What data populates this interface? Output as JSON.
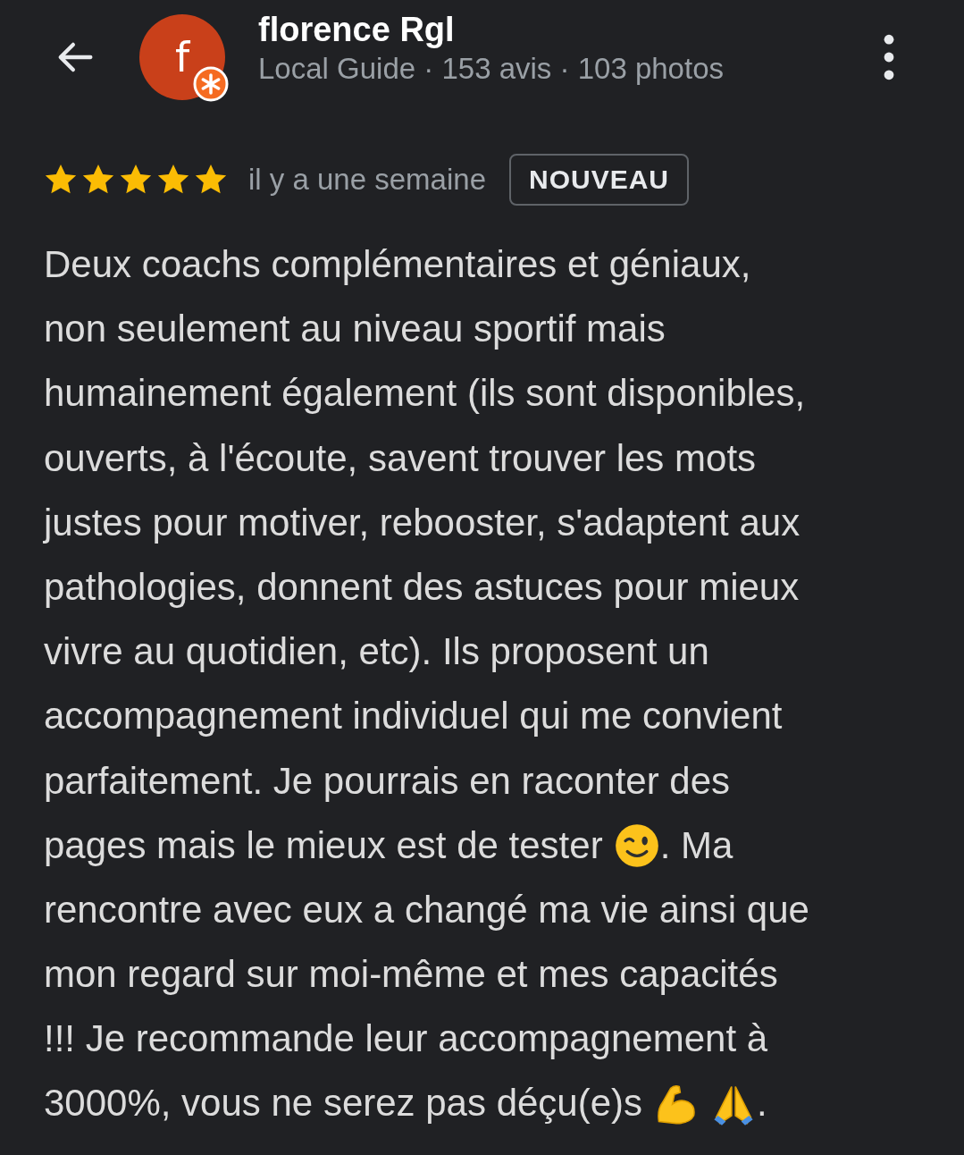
{
  "header": {
    "name": "florence Rgl",
    "avatar_letter": "f",
    "subtitle": "Local Guide · 153 avis · 103 photos"
  },
  "review": {
    "stars": 5,
    "time": "il y a une semaine",
    "badge": "NOUVEAU",
    "lines": [
      [
        {
          "kind": "text",
          "text": "Deux coachs complémentaires et géniaux,"
        }
      ],
      [
        {
          "kind": "text",
          "text": "non seulement au niveau sportif mais"
        }
      ],
      [
        {
          "kind": "text",
          "text": "humainement également (ils sont disponibles,"
        }
      ],
      [
        {
          "kind": "text",
          "text": "ouverts, à l'écoute, savent trouver les mots"
        }
      ],
      [
        {
          "kind": "text",
          "text": "justes pour motiver, rebooster, s'adaptent aux"
        }
      ],
      [
        {
          "kind": "text",
          "text": "pathologies, donnent des astuces pour mieux"
        }
      ],
      [
        {
          "kind": "text",
          "text": "vivre au quotidien, etc). Ils proposent un"
        }
      ],
      [
        {
          "kind": "text",
          "text": "accompagnement individuel qui me convient"
        }
      ],
      [
        {
          "kind": "text",
          "text": "parfaitement. Je pourrais en raconter des"
        }
      ],
      [
        {
          "kind": "text",
          "text": "pages mais le mieux est de tester"
        },
        {
          "kind": "wink"
        },
        {
          "kind": "text",
          "text": ". Ma"
        }
      ],
      [
        {
          "kind": "text",
          "text": "rencontre avec eux a changé ma vie ainsi que"
        }
      ],
      [
        {
          "kind": "text",
          "text": "mon regard sur moi-même et mes capacités"
        }
      ],
      [
        {
          "kind": "text",
          "text": "!!! Je recommande leur accompagnement à"
        }
      ],
      [
        {
          "kind": "text",
          "text": "3000%, vous ne serez pas déçu(e)s"
        },
        {
          "kind": "flex"
        },
        {
          "kind": "pray"
        },
        {
          "kind": "text",
          "text": "."
        }
      ]
    ]
  }
}
